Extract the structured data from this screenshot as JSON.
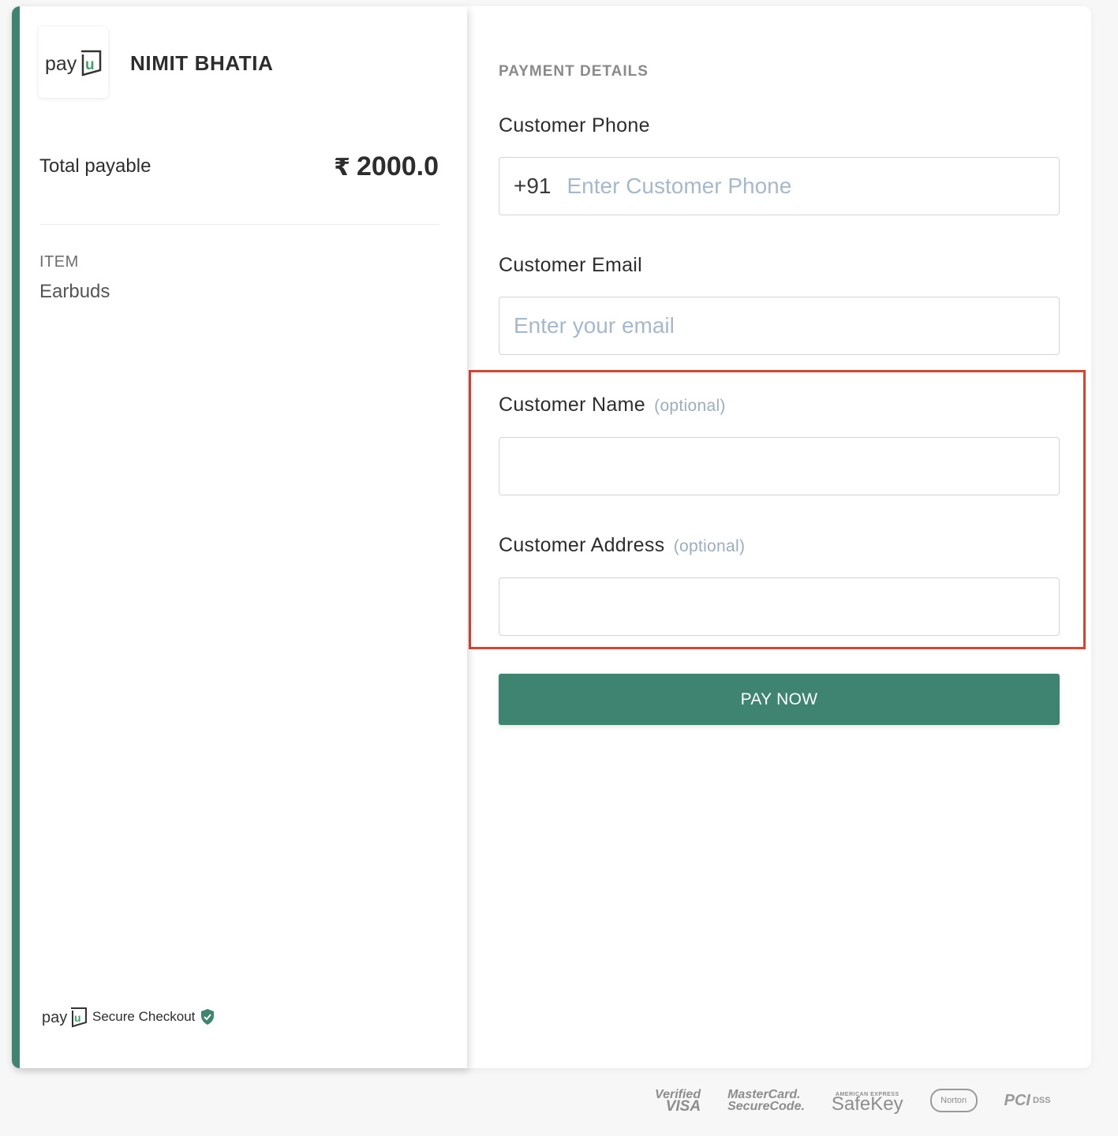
{
  "merchant": {
    "name": "NIMIT BHATIA",
    "logo_text": "payu"
  },
  "summary": {
    "total_label": "Total payable",
    "currency_symbol": "₹",
    "total_amount": "2000.0",
    "item_label": "ITEM",
    "item_value": "Earbuds"
  },
  "footer": {
    "secure_label": "Secure Checkout",
    "logo_text": "payu"
  },
  "form": {
    "section_title": "PAYMENT DETAILS",
    "phone": {
      "label": "Customer Phone",
      "prefix": "+91",
      "placeholder": "Enter Customer Phone",
      "value": ""
    },
    "email": {
      "label": "Customer Email",
      "placeholder": "Enter your email",
      "value": ""
    },
    "name": {
      "label": "Customer Name",
      "optional": "(optional)",
      "value": ""
    },
    "address": {
      "label": "Customer Address",
      "optional": "(optional)",
      "value": ""
    },
    "pay_button": "PAY NOW"
  },
  "trust_badges": {
    "visa_1": "Verified",
    "visa_2": "VISA",
    "mc_1": "MasterCard.",
    "mc_2": "SecureCode.",
    "amex_small": "AMERICAN EXPRESS",
    "amex": "SafeKey",
    "norton": "Norton",
    "pci": "PCI",
    "dss": "DSS"
  },
  "colors": {
    "brand": "#3e8470",
    "highlight": "#d9442f",
    "placeholder": "#a6b9cc"
  }
}
